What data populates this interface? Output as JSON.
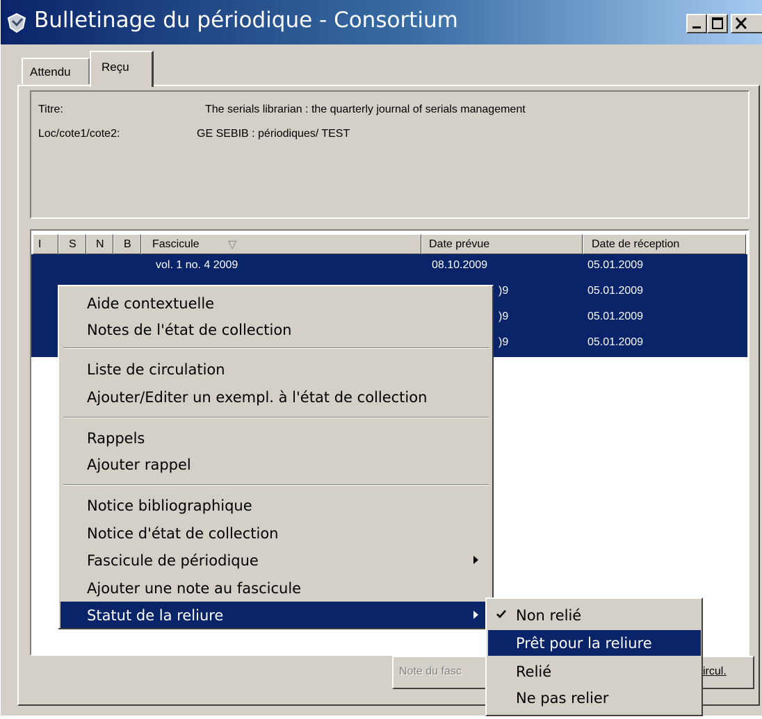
{
  "window": {
    "title": "Bulletinage du périodique - Consortium",
    "controls": {
      "minimize": "_",
      "maximize": "□",
      "close": "X"
    }
  },
  "tabs": [
    {
      "label": "Attendu",
      "active": false
    },
    {
      "label": "Reçu",
      "active": true
    }
  ],
  "info": {
    "titre_label": "Titre:",
    "titre_value": "The serials librarian : the quarterly journal of serials management",
    "loc_label": "Loc/cote1/cote2:",
    "loc_value": "GE SEBIB : périodiques/ TEST"
  },
  "table": {
    "columns": [
      "I",
      "S",
      "N",
      "B",
      "Fascicule",
      "Date prévue",
      "Date de réception"
    ],
    "sort_indicator": "▽",
    "rows": [
      {
        "fascicule": "vol. 1 no. 4   2009",
        "date_prevue": "08.10.2009",
        "date_reception": "05.01.2009"
      },
      {
        "fascicule": "",
        "date_prevue": ")9",
        "date_reception": "05.01.2009"
      },
      {
        "fascicule": "",
        "date_prevue": ")9",
        "date_reception": "05.01.2009"
      },
      {
        "fascicule": "",
        "date_prevue": ")9",
        "date_reception": "05.01.2009"
      }
    ]
  },
  "context_menu": {
    "groups": [
      [
        "Aide contextuelle",
        "Notes de l'état de collection"
      ],
      [
        "Liste de circulation",
        "Ajouter/Editer un exempl. à l'état de collection"
      ],
      [
        "Rappels",
        "Ajouter rappel"
      ],
      [
        "Notice bibliographique",
        "Notice d'état de collection",
        "Fascicule de périodique",
        "Ajouter une note au fascicule",
        "Statut de la reliure"
      ]
    ],
    "highlighted": "Statut de la reliure"
  },
  "submenu": {
    "items": [
      "Non relié",
      "Prêt pour la reliure",
      "Relié",
      "Ne pas relier"
    ],
    "checked": "Non relié",
    "highlighted": "Prêt pour la reliure"
  },
  "buttons": {
    "note_label": "Note du fasc",
    "circ_label": "ircul."
  },
  "colors": {
    "selection": "#0a246a",
    "face": "#d4d0c8"
  }
}
